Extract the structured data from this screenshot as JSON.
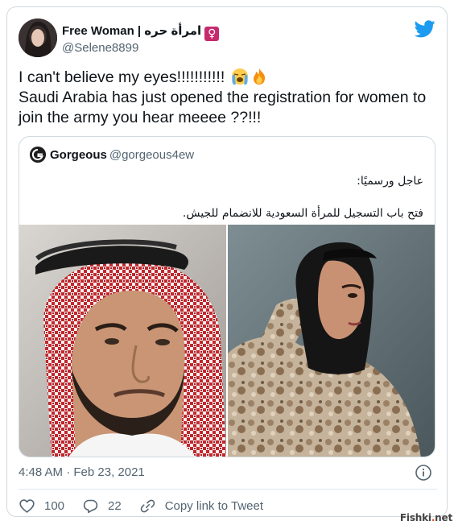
{
  "author": {
    "display_name": "Free Woman | امرأة حره",
    "venus_symbol": "♀",
    "handle": "@Selene8899"
  },
  "tweet": {
    "line1": "I can't believe my eyes!!!!!!!!!!! ",
    "line2": "Saudi Arabia has just opened the registration for women to",
    "line3": "join the army you hear meeee ??!!!",
    "emojis": [
      "loudly-crying-face-emoji",
      "fire-emoji"
    ]
  },
  "quote": {
    "display_name": "Gorgeous",
    "handle": "@gorgeous4ew",
    "text_line1": "عاجل ورسميًا:",
    "text_line2": "فتح باب التسجيل للمرأة السعودية للانضمام للجيش."
  },
  "meta": {
    "timestamp": "4:48 AM · Feb 23, 2021"
  },
  "actions": {
    "likes": "100",
    "replies": "22",
    "copy_link": "Copy link to Tweet"
  },
  "watermark": {
    "text_main": "Fishki",
    "text_dot": ".",
    "text_end": "net"
  },
  "colors": {
    "twitter_blue": "#1d9bf0",
    "secondary_text": "#536471",
    "border": "#cfd9de"
  }
}
